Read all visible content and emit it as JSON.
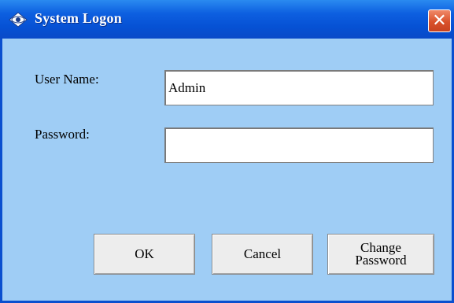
{
  "window": {
    "title": "System Logon",
    "close_label": "✕"
  },
  "form": {
    "username_label": "User Name:",
    "username_value": "Admin",
    "password_label": "Password:",
    "password_value": ""
  },
  "buttons": {
    "ok": "OK",
    "cancel": "Cancel",
    "change_password_line1": "Change",
    "change_password_line2": "Password"
  },
  "colors": {
    "background": "#9fcdf5",
    "titlebar": "#0651d4",
    "close": "#d9512b"
  },
  "icons": {
    "app": "eye-diamond-icon",
    "close": "close-icon"
  }
}
